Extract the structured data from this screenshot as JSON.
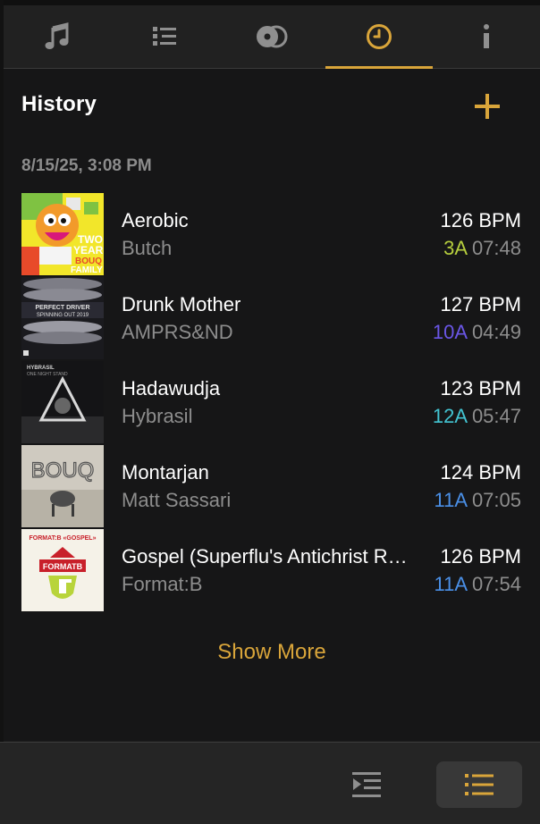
{
  "tabs": [
    {
      "icon": "music-note-icon"
    },
    {
      "icon": "list-icon"
    },
    {
      "icon": "disc-icon"
    },
    {
      "icon": "clock-icon",
      "active": true
    },
    {
      "icon": "info-icon"
    }
  ],
  "history": {
    "title": "History",
    "add_icon": "plus-icon",
    "date_label": "8/15/25, 3:08 PM",
    "tracks": [
      {
        "title": "Aerobic",
        "artist": "Butch",
        "bpm": "126 BPM",
        "key": "3A",
        "key_color": "#b7cf3e",
        "duration": "07:48"
      },
      {
        "title": "Drunk Mother",
        "artist": "AMPRS&ND",
        "bpm": "127 BPM",
        "key": "10A",
        "key_color": "#6a56e6",
        "duration": "04:49"
      },
      {
        "title": "Hadawudja",
        "artist": "Hybrasil",
        "bpm": "123 BPM",
        "key": "12A",
        "key_color": "#43c4d2",
        "duration": "05:47"
      },
      {
        "title": "Montarjan",
        "artist": "Matt Sassari",
        "bpm": "124 BPM",
        "key": "11A",
        "key_color": "#4a8fe6",
        "duration": "07:05"
      },
      {
        "title": "Gospel (Superflu's Antichrist Remix)",
        "artist": "Format:B",
        "bpm": "126 BPM",
        "key": "11A",
        "key_color": "#4a8fe6",
        "duration": "07:54"
      }
    ],
    "show_more": "Show More"
  },
  "art_text": {
    "t1_line1": "TWO",
    "t1_line2": "YEARS",
    "t1_line3": "BOUQ",
    "t1_line4": "FAMILY",
    "t2_line1": "PERFECT DRIVER",
    "t2_line2": "SPINNING OUT 2019",
    "t3_line1": "HYBRASIL",
    "t3_line2": "ONE NIGHT STAND",
    "t4_line1": "BOUQ",
    "t5_line1": "FORMAT:B «GOSPEL»",
    "t5_line2": "FORMATB"
  },
  "footer": {
    "queue_icon": "play-queue-icon",
    "list_icon": "list-view-icon"
  },
  "colors": {
    "accent": "#d9a53a",
    "background": "#161617",
    "secondary_text": "#8d8d8d"
  }
}
